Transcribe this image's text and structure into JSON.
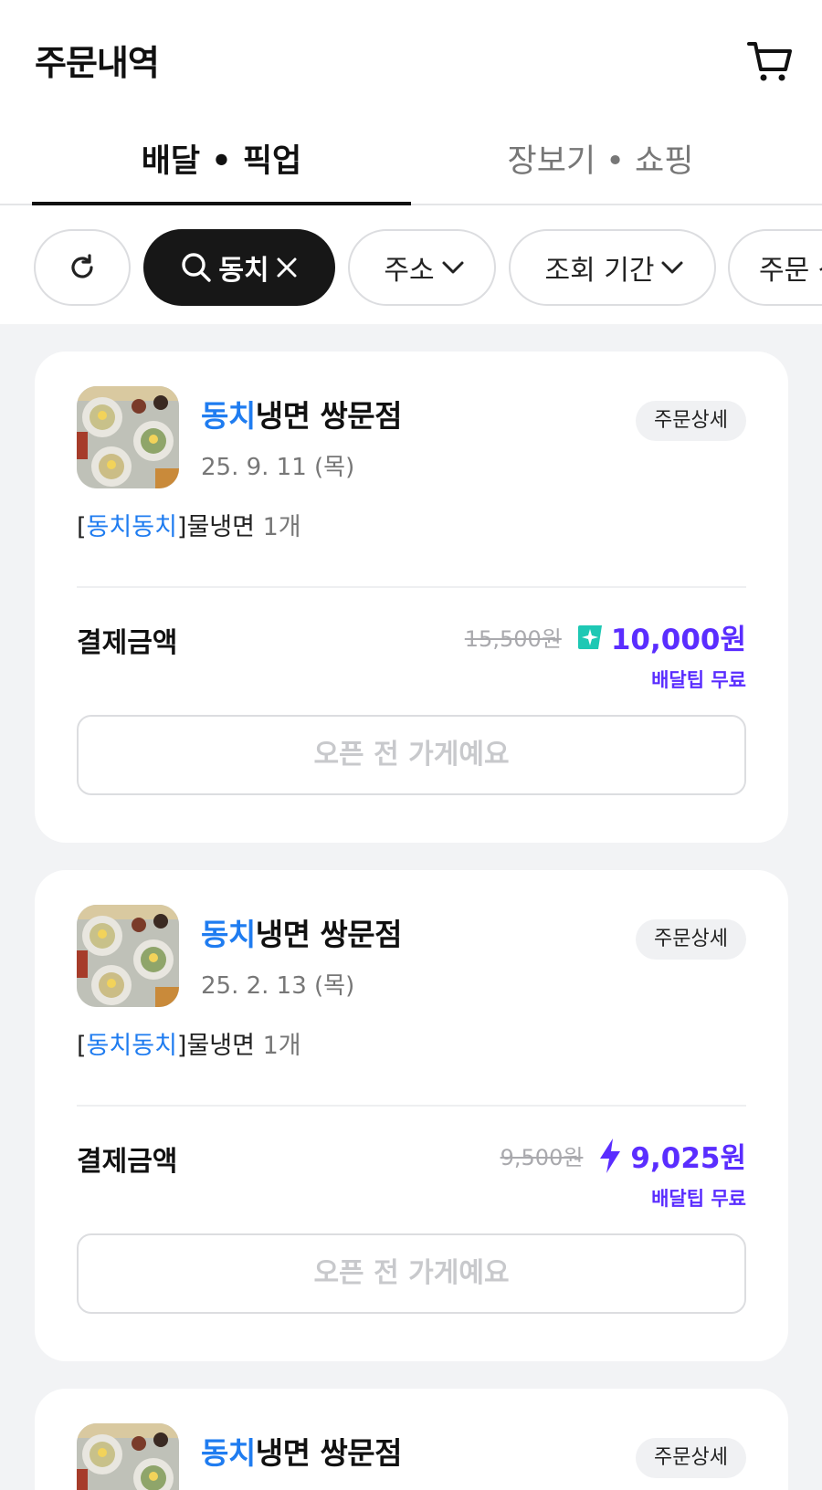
{
  "header": {
    "title": "주문내역",
    "cart_icon": "cart-icon"
  },
  "tabs": [
    {
      "label": "배달 • 픽업",
      "active": true
    },
    {
      "label": "장보기 • 쇼핑",
      "active": false
    }
  ],
  "filters": {
    "refresh_icon": "refresh-icon",
    "search_chip": {
      "label": "동치",
      "icon": "search-icon",
      "clear_icon": "close-icon"
    },
    "address_chip": "주소",
    "period_chip": "조회 기간",
    "order_chip": "주문 상"
  },
  "orders": [
    {
      "store_highlight": "동치",
      "store_rest": "냉면 쌍문점",
      "date": "25. 9. 11 (목)",
      "detail_label": "주문상세",
      "item_open": "[",
      "item_highlight": "동치동치",
      "item_rest": "]물냉면",
      "item_qty": "1개",
      "pay_label": "결제금액",
      "original_price": "15,500원",
      "final_price": "10,000원",
      "badge_icon": "sparkle-badge-icon",
      "delivery_fee": "배달팁 무료",
      "status_button": "오픈 전 가게예요"
    },
    {
      "store_highlight": "동치",
      "store_rest": "냉면 쌍문점",
      "date": "25. 2. 13 (목)",
      "detail_label": "주문상세",
      "item_open": "[",
      "item_highlight": "동치동치",
      "item_rest": "]물냉면",
      "item_qty": "1개",
      "pay_label": "결제금액",
      "original_price": "9,500원",
      "final_price": "9,025원",
      "badge_icon": "lightning-icon",
      "delivery_fee": "배달팁 무료",
      "status_button": "오픈 전 가게예요"
    },
    {
      "store_highlight": "동치",
      "store_rest": "냉면 쌍문점",
      "detail_label": "주문상세"
    }
  ],
  "colors": {
    "highlight": "#1f7cf0",
    "price": "#5a2dff",
    "badge_teal": "#1ec8b4"
  }
}
